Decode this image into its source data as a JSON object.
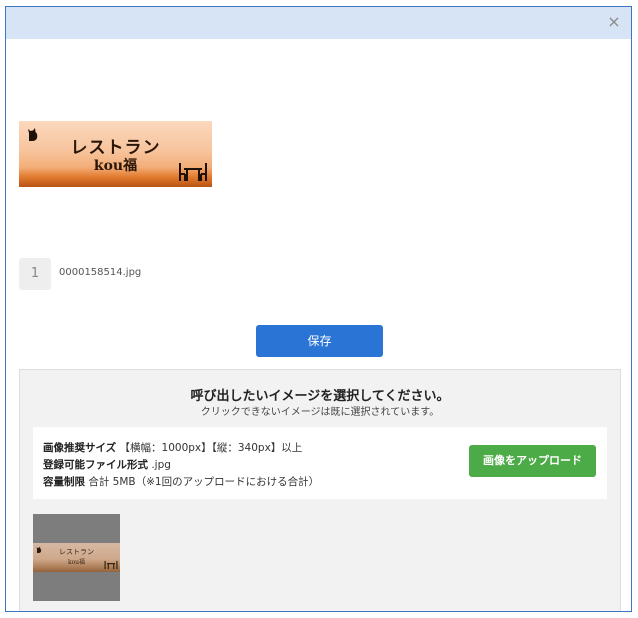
{
  "dialog": {
    "close_label": "×"
  },
  "banner": {
    "title": "レストラン",
    "subtitle": "kou福"
  },
  "file": {
    "number": "1",
    "name": "0000158514.jpg"
  },
  "actions": {
    "save_label": "保存"
  },
  "select_panel": {
    "title": "呼び出したいイメージを選択してください。",
    "subtitle": "クリックできないイメージは既に選択されています。",
    "spec": {
      "size_label": "画像推奨サイズ",
      "size_value": "【横幅：1000px】【縦：340px】以上",
      "format_label": "登録可能ファイル形式",
      "format_value": ".jpg",
      "capacity_label": "容量制限",
      "capacity_value": "合計 5MB（※1回のアップロードにおける合計）"
    },
    "upload_label": "画像をアップロード",
    "thumbnail": {
      "title": "レストラン",
      "subtitle": "kou福"
    }
  },
  "colors": {
    "titlebar": "#d7e4f5",
    "save_button": "#2a74d5",
    "upload_button": "#4dab47"
  }
}
